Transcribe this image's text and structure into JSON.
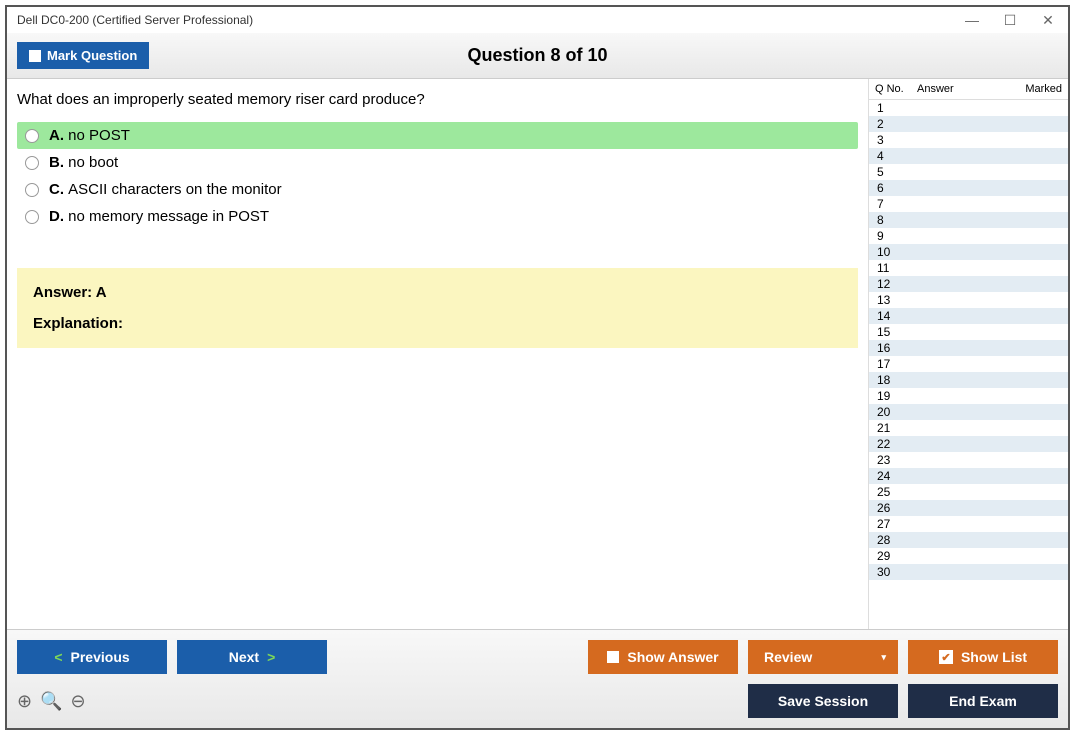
{
  "titlebar": {
    "title": "Dell DC0-200 (Certified Server Professional)"
  },
  "header": {
    "mark_label": "Mark Question",
    "question_title": "Question 8 of 10"
  },
  "question": {
    "text": "What does an improperly seated memory riser card produce?",
    "options": [
      {
        "letter": "A.",
        "text": "no POST",
        "highlighted": true
      },
      {
        "letter": "B.",
        "text": "no boot",
        "highlighted": false
      },
      {
        "letter": "C.",
        "text": "ASCII characters on the monitor",
        "highlighted": false
      },
      {
        "letter": "D.",
        "text": "no memory message in POST",
        "highlighted": false
      }
    ]
  },
  "answer": {
    "label": "Answer: A",
    "explanation_label": "Explanation:"
  },
  "sidebar": {
    "col_qno": "Q No.",
    "col_answer": "Answer",
    "col_marked": "Marked",
    "rows": [
      "1",
      "2",
      "3",
      "4",
      "5",
      "6",
      "7",
      "8",
      "9",
      "10",
      "11",
      "12",
      "13",
      "14",
      "15",
      "16",
      "17",
      "18",
      "19",
      "20",
      "21",
      "22",
      "23",
      "24",
      "25",
      "26",
      "27",
      "28",
      "29",
      "30"
    ]
  },
  "footer": {
    "previous": "Previous",
    "next": "Next",
    "show_answer": "Show Answer",
    "review": "Review",
    "show_list": "Show List",
    "save_session": "Save Session",
    "end_exam": "End Exam"
  }
}
